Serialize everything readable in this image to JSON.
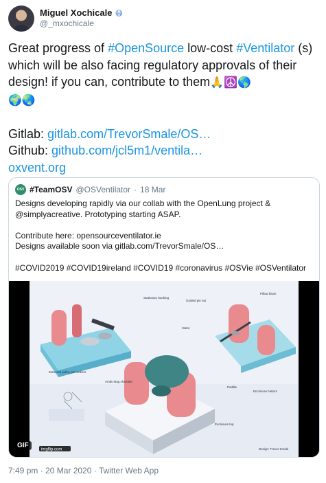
{
  "author": {
    "name": "Miguel Xochicale",
    "badge_emoji": "😷",
    "handle": "@_mxochicale"
  },
  "tweet": {
    "line1_a": "Great progress of ",
    "hashtag1": "#OpenSource",
    "line1_b": " low-cost ",
    "hashtag2": "#Ventilator",
    "line2": "(s) which will be also facing regulatory approvals of their design! if you can, contribute to them",
    "emojis_1": "🙏☮️🌎",
    "emojis_2": "🌍🌏",
    "gitlab_label": "Gitlab: ",
    "gitlab_link": "gitlab.com/TrevorSmale/OS…",
    "github_label": "Github: ",
    "github_link": "github.com/jcl5m1/ventila…",
    "site_link": "oxvent.org"
  },
  "quoted": {
    "logo_text": "OSV",
    "name": "#TeamOSV",
    "handle": "@OSVentilator",
    "separator": " · ",
    "date": "18 Mar",
    "text": "Designs developing rapidly via our collab with the OpenLung project & @simplyacreative. Prototyping starting ASAP.\n\nContribute here: opensourceventilator.ie\nDesigns available soon via gitlab.com/TrevorSmale/OS…\n\n#COVID2019 #COVID19ireland #COVID19 #coronavirus #OSVie #OSVentilator",
    "media_badge": "GIF",
    "media_labels": {
      "stationary": "Stationary backing",
      "guided": "Guided pin nut",
      "pillow": "Pillow block",
      "motor": "Motor",
      "pulley": "Extruded pulley pin rockers",
      "ambu": "Ambu-Bag chamber",
      "paddle": "Paddle",
      "enclosure_bottom": "Enclosure bottom",
      "enclosure_top": "Enclosure top",
      "design": "Design: Trevor Smale",
      "watermark": "imgflip.com"
    }
  },
  "footer": {
    "timestamp": "7:49 pm · 20 Mar 2020 · Twitter Web App"
  }
}
